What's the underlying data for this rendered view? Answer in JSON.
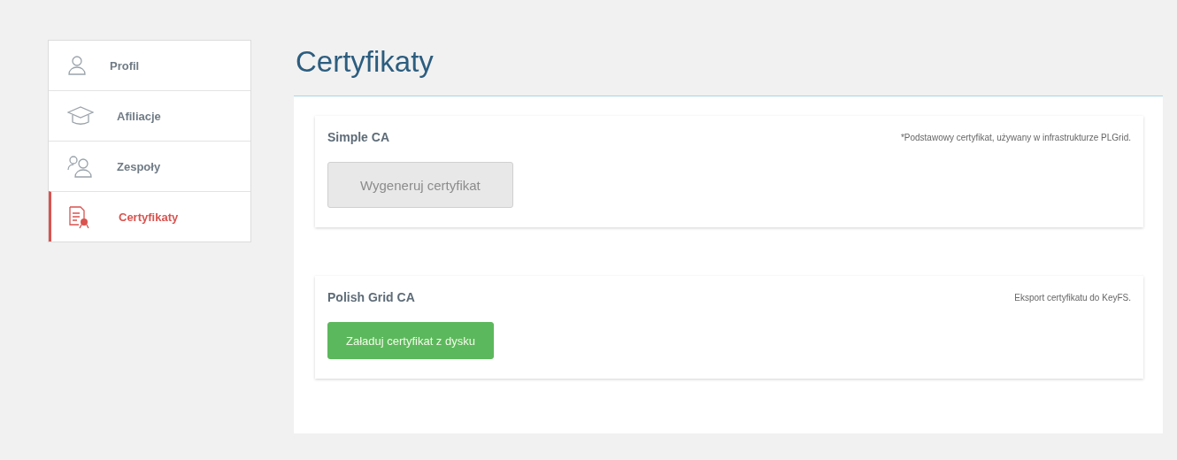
{
  "sidebar": {
    "items": [
      {
        "label": "Profil",
        "selected": false
      },
      {
        "label": "Afiliacje",
        "selected": false
      },
      {
        "label": "Zespoły",
        "selected": false
      },
      {
        "label": "Certyfikaty",
        "selected": true
      }
    ]
  },
  "title": "Certyfikaty",
  "cards": [
    {
      "title": "Simple CA",
      "note": "*Podstawowy certyfikat, używany w infrastrukturze PLGrid.",
      "button": {
        "label": "Wygeneruj certyfikat",
        "disabled": true
      }
    },
    {
      "title": "Polish Grid CA",
      "note": "Eksport certyfikatu do KeyFS.",
      "button": {
        "label": "Załaduj certyfikat z dysku",
        "disabled": false
      }
    }
  ]
}
